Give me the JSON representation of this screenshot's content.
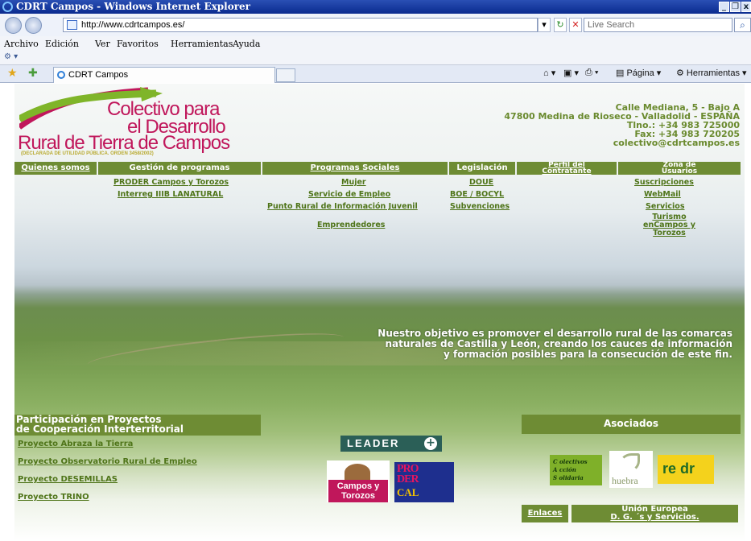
{
  "window": {
    "title": "CDRT Campos - Windows Internet Explorer",
    "controls": [
      "_",
      "❐",
      "x"
    ]
  },
  "browser": {
    "address": "http://www.cdrtcampos.es/",
    "search_placeholder": "Live Search",
    "menu": [
      "Archivo",
      "Edición",
      "Ver",
      "Favoritos",
      "Herramientas",
      "Ayuda"
    ],
    "tab_title": "CDRT Campos",
    "commands": {
      "page": "Página ▾",
      "tools": "Herramientas ▾"
    }
  },
  "site": {
    "logo": {
      "line1": "Colectivo para",
      "line2": "el Desarrollo",
      "line3": "Rural de Tierra de Campos",
      "note": "(DECLARADA DE UTILIDAD PÚBLICA. ORDEN 3458/2002)"
    },
    "contact": {
      "street": "Calle Mediana, 5 - Bajo A",
      "city": "47800 Medina de Rioseco - Valladolid - ESPAÑA",
      "phone": "Tlno.: +34 983 725000",
      "fax": "Fax: +34 983 720205",
      "email": "colectivo@cdrtcampos.es"
    },
    "nav": {
      "quienes": "Quienes somos",
      "gestion": "Gestión de programas",
      "programas": "Programas Sociales",
      "legislacion": "Legislación",
      "perfil_1": "Perfil del",
      "perfil_2": "Contratante",
      "zona_1": "Zona de",
      "zona_2": "Usuarios"
    },
    "submenus": {
      "gestion": [
        "PRODER Campos y Torozos",
        "Interreg IIIB LANATURAL"
      ],
      "programas": [
        "Mujer",
        "Servicio de Empleo",
        "Punto Rural de Información Juvenil",
        "Emprendedores"
      ],
      "legislacion": [
        "DOUE",
        "BOE / BOCYL",
        "Subvenciones"
      ],
      "zona": [
        "Suscripciones",
        "WebMail",
        "Servicios"
      ],
      "zona_turismo": [
        "Turismo",
        "enCampos y",
        "Torozos"
      ]
    },
    "mission": [
      "Nuestro objetivo es promover el desarrollo rural de las comarcas",
      "naturales de Castilla y León, creando los cauces de información",
      "y formación posibles para la consecución de este fin."
    ],
    "participacion": {
      "title_1": "Participación en Proyectos",
      "title_2": "de Cooperación Interterritorial",
      "links": [
        "Proyecto Abraza la Tierra",
        "Proyecto Observatorio Rural de Empleo",
        "Proyecto DESEMILLAS",
        "Proyecto TRINO"
      ]
    },
    "asociados": "Asociados",
    "badges": {
      "leader": "LEADER",
      "leader_plus": "+",
      "campos_1": "Campos y",
      "campos_2": "Torozos",
      "proder_1": "PRO",
      "proder_2": "DER",
      "proder_3": "CAL",
      "colectivos": [
        "C olectivos",
        "A cción",
        "S olidaria"
      ],
      "huebra": "huebra",
      "redr": "re dr"
    },
    "footer": {
      "enlaces": "Enlaces",
      "ue_1": "Unión Europea",
      "ue_2": "D. G. ´s y Servicios."
    }
  }
}
